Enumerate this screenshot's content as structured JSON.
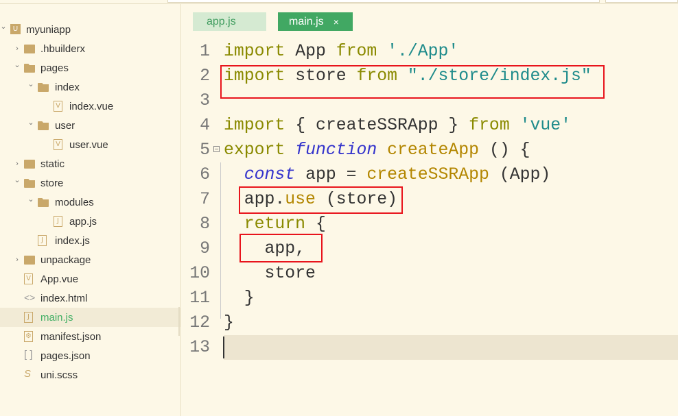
{
  "sidebar": {
    "items": [
      {
        "label": "myuniapp",
        "level": 0,
        "type": "project",
        "expanded": true
      },
      {
        "label": ".hbuilderx",
        "level": 1,
        "type": "folder",
        "expanded": false
      },
      {
        "label": "pages",
        "level": 1,
        "type": "folder",
        "expanded": true
      },
      {
        "label": "index",
        "level": 2,
        "type": "folder",
        "expanded": true
      },
      {
        "label": "index.vue",
        "level": 3,
        "type": "vue"
      },
      {
        "label": "user",
        "level": 2,
        "type": "folder",
        "expanded": true
      },
      {
        "label": "user.vue",
        "level": 3,
        "type": "vue"
      },
      {
        "label": "static",
        "level": 1,
        "type": "folder",
        "expanded": false
      },
      {
        "label": "store",
        "level": 1,
        "type": "folder",
        "expanded": true
      },
      {
        "label": "modules",
        "level": 2,
        "type": "folder",
        "expanded": true
      },
      {
        "label": "app.js",
        "level": 3,
        "type": "js"
      },
      {
        "label": "index.js",
        "level": 2,
        "type": "js"
      },
      {
        "label": "unpackage",
        "level": 1,
        "type": "folder",
        "expanded": false
      },
      {
        "label": "App.vue",
        "level": 1,
        "type": "vue"
      },
      {
        "label": "index.html",
        "level": 1,
        "type": "html"
      },
      {
        "label": "main.js",
        "level": 1,
        "type": "js",
        "selected": true
      },
      {
        "label": "manifest.json",
        "level": 1,
        "type": "manifest"
      },
      {
        "label": "pages.json",
        "level": 1,
        "type": "json"
      },
      {
        "label": "uni.scss",
        "level": 1,
        "type": "scss"
      }
    ]
  },
  "tabs": [
    {
      "label": "app.js",
      "active": false
    },
    {
      "label": "main.js",
      "active": true,
      "close": "×"
    }
  ],
  "editor": {
    "lines": [
      [
        [
          "kw",
          "import"
        ],
        [
          "",
          "App "
        ],
        [
          "kw",
          "from"
        ],
        [
          "",
          ""
        ],
        [
          "str",
          "'./App'"
        ]
      ],
      [
        [
          "kw",
          "import"
        ],
        [
          "",
          "store "
        ],
        [
          "kw",
          "from"
        ],
        [
          "str",
          "\"./store/index.js\""
        ]
      ],
      [],
      [
        [
          "kw",
          "import"
        ],
        [
          "",
          "{ createSSRApp } "
        ],
        [
          "kw",
          "from"
        ],
        [
          "str",
          "'vue'"
        ]
      ],
      [
        [
          "kw",
          "export"
        ],
        [
          "fn",
          "function"
        ],
        [
          "call",
          "createApp"
        ],
        [
          "",
          "() {"
        ]
      ],
      [
        [
          "",
          "  "
        ],
        [
          "kw2",
          "const"
        ],
        [
          "",
          "app = "
        ],
        [
          "call",
          "createSSRApp"
        ],
        [
          "",
          "(App)"
        ]
      ],
      [
        [
          "",
          "  app."
        ],
        [
          "call",
          "use"
        ],
        [
          "",
          "(store)"
        ]
      ],
      [
        [
          "",
          "  "
        ],
        [
          "kw",
          "return"
        ],
        [
          "",
          "{"
        ]
      ],
      [
        [
          "",
          "    app,"
        ]
      ],
      [
        [
          "",
          "    store"
        ]
      ],
      [
        [
          "",
          "  }"
        ]
      ],
      [
        [
          "",
          "}"
        ]
      ],
      []
    ]
  },
  "colors": {
    "accent": "#41a863",
    "highlight_box": "#e8141c"
  }
}
